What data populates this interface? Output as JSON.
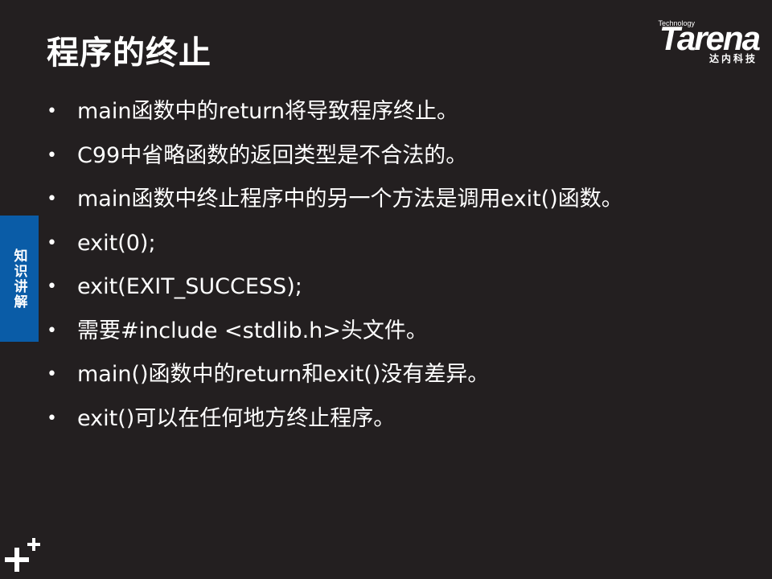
{
  "slide": {
    "title": "程序的终止",
    "side_tab": "知识讲解"
  },
  "logo": {
    "tagline": "Technology",
    "word": "Tarena",
    "chinese": "达内科技"
  },
  "bullet_symbol": "•",
  "bullets": [
    "main函数中的return将导致程序终止。",
    "C99中省略函数的返回类型是不合法的。",
    "main函数中终止程序中的另一个方法是调用exit()函数。",
    "exit(0);",
    "exit(EXIT_SUCCESS);",
    "需要#include <stdlib.h>头文件。",
    "main()函数中的return和exit()没有差异。",
    "exit()可以在任何地方终止程序。"
  ],
  "icons": {
    "corner": "plus-icon"
  },
  "colors": {
    "background": "#231f20",
    "text": "#ffffff",
    "side_tab": "#0a5ca7"
  }
}
